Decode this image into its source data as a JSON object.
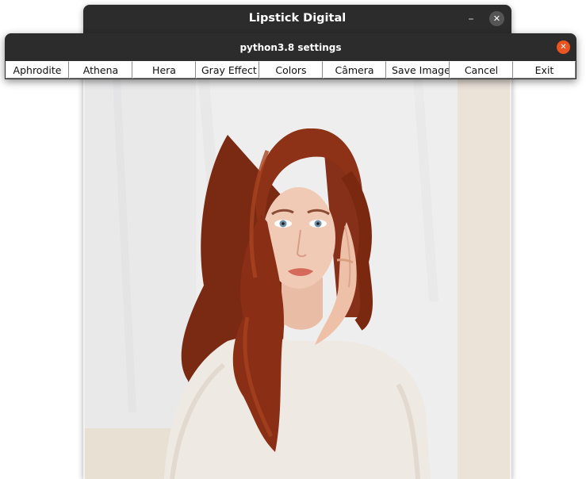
{
  "main_window": {
    "title": "Lipstick Digital",
    "minimize_glyph": "–",
    "close_glyph": "✕"
  },
  "settings_window": {
    "title": "python3.8 settings",
    "close_glyph": "✕",
    "buttons": [
      "Aphrodite",
      "Athena",
      "Hera",
      "Gray Effect",
      "Colors",
      "Câmera",
      "Save Image",
      "Cancel",
      "Exit"
    ]
  },
  "photo": {
    "icon": "portrait-photo"
  },
  "colors": {
    "titlebar": "#2c2c2c",
    "settings_close": "#e95420",
    "main_close": "#555555"
  }
}
